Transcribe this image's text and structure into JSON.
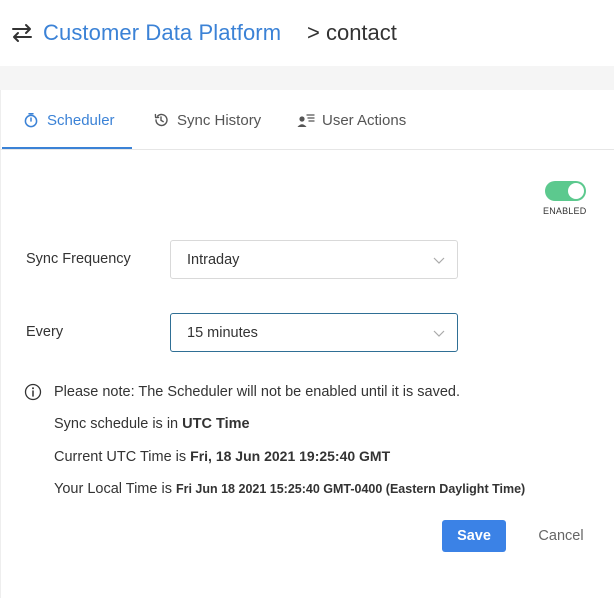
{
  "header": {
    "icon": "swap-arrows-icon",
    "title_link": "Customer Data Platform",
    "title_rest": "> contact",
    "accent_color": "#3b82d6"
  },
  "tabs": [
    {
      "label": "Scheduler",
      "icon": "stopwatch-icon",
      "active": true
    },
    {
      "label": "Sync History",
      "icon": "history-icon",
      "active": false
    },
    {
      "label": "User Actions",
      "icon": "user-list-icon",
      "active": false
    }
  ],
  "toggle": {
    "state": "on",
    "label": "ENABLED",
    "color": "#5cc98e"
  },
  "form": {
    "sync_frequency": {
      "label": "Sync Frequency",
      "value": "Intraday"
    },
    "every": {
      "label": "Every",
      "value": "15 minutes"
    }
  },
  "notes": {
    "note": "Please note: The Scheduler will not be enabled until it is saved.",
    "schedule_prefix": "Sync schedule is in ",
    "schedule_value": "UTC Time",
    "utc_prefix": "Current UTC Time is ",
    "utc_value": "Fri, 18 Jun 2021 19:25:40 GMT",
    "local_prefix": "Your Local Time is ",
    "local_value": "Fri Jun 18 2021 15:25:40 GMT-0400 (Eastern Daylight Time)"
  },
  "actions": {
    "save_label": "Save",
    "cancel_label": "Cancel",
    "save_color": "#3b82e6"
  }
}
